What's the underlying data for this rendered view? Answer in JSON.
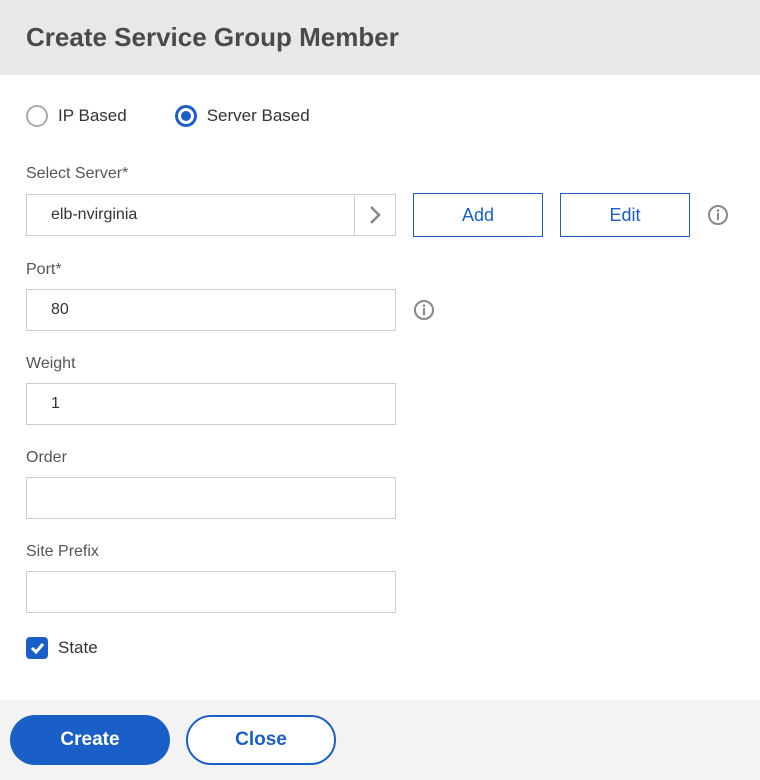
{
  "header": {
    "title": "Create Service Group Member"
  },
  "typeRadio": {
    "options": [
      {
        "label": "IP Based",
        "selected": false
      },
      {
        "label": "Server Based",
        "selected": true
      }
    ]
  },
  "fields": {
    "selectServer": {
      "label": "Select Server*",
      "value": "elb-nvirginia",
      "addLabel": "Add",
      "editLabel": "Edit"
    },
    "port": {
      "label": "Port*",
      "value": "80"
    },
    "weight": {
      "label": "Weight",
      "value": "1"
    },
    "order": {
      "label": "Order",
      "value": ""
    },
    "sitePrefix": {
      "label": "Site Prefix",
      "value": ""
    },
    "state": {
      "label": "State",
      "checked": true
    }
  },
  "footer": {
    "createLabel": "Create",
    "closeLabel": "Close"
  }
}
